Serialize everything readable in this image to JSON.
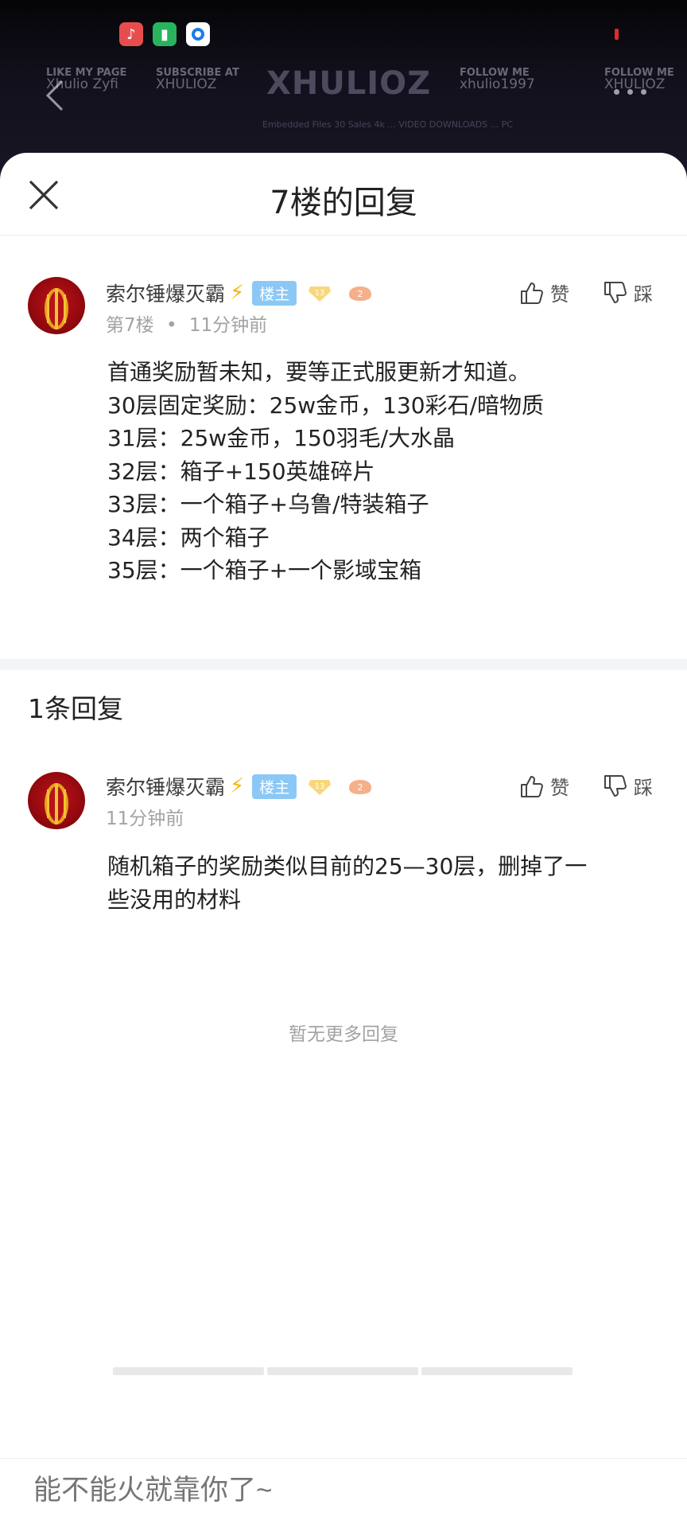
{
  "background": {
    "banner": {
      "like_label": "LIKE MY PAGE",
      "like_name": "Xhulio Zyfi",
      "subscribe_label": "SUBSCRIBE AT",
      "subscribe_name": "XHULIOZ",
      "logo": "XHULIOZ",
      "follow_label": "FOLLOW ME",
      "twitter_name": "xhulio1997",
      "follow_label_2": "FOLLOW ME",
      "instagram_name": "XHULIOZ"
    },
    "banner_line": "Embedded Files 30 Sales 4k ... VIDEO DOWNLOADS ... PC"
  },
  "sheet": {
    "title": "7楼的回复"
  },
  "main_comment": {
    "username": "索尔锤爆灭霸",
    "lz_badge": "楼主",
    "level": "13",
    "rank": "2",
    "floor": "第7楼",
    "separator": "•",
    "time": "11分钟前",
    "like_label": "赞",
    "dislike_label": "踩",
    "lines": [
      "首通奖励暂未知，要等正式服更新才知道。",
      "30层固定奖励：25w金币，130彩石/暗物质",
      "31层：25w金币，150羽毛/大水晶",
      "32层：箱子+150英雄碎片",
      "33层：一个箱子+乌鲁/特装箱子",
      "34层：两个箱子",
      "35层：一个箱子+一个影域宝箱"
    ]
  },
  "replies": {
    "count_label": "1条回复",
    "items": [
      {
        "username": "索尔锤爆灭霸",
        "lz_badge": "楼主",
        "level": "13",
        "rank": "2",
        "time": "11分钟前",
        "like_label": "赞",
        "dislike_label": "踩",
        "lines": [
          "随机箱子的奖励类似目前的25—30层，删掉了一",
          "些没用的材料"
        ]
      }
    ],
    "no_more": "暂无更多回复"
  },
  "bottom": {
    "input_placeholder": "能不能火就靠你了~"
  },
  "colors": {
    "lz_badge_bg": "#8cc8f5",
    "bolt": "#f5b400",
    "muted": "#a3a3a3",
    "level_badge": "#f2c04a",
    "rank_badge": "#f09a6a"
  }
}
